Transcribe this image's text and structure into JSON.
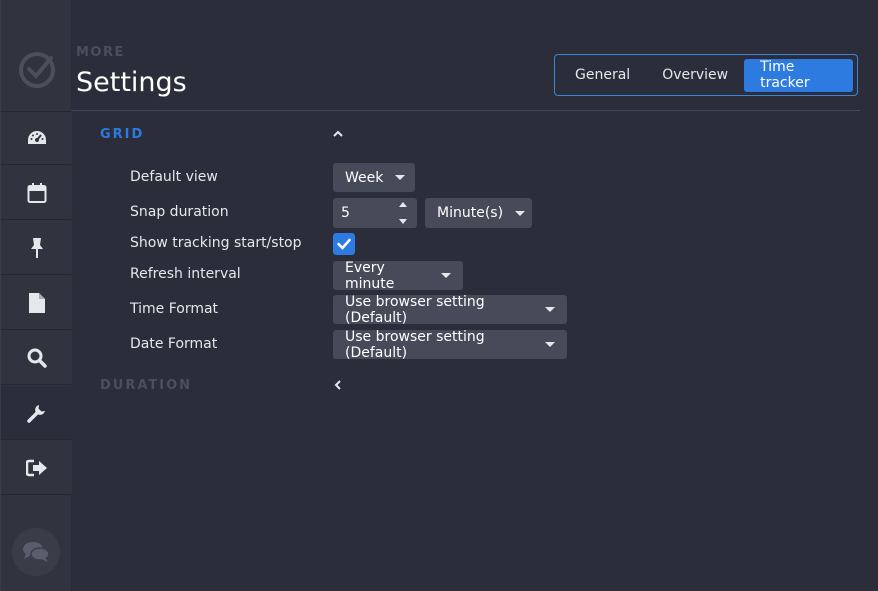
{
  "header": {
    "breadcrumb": "MORE",
    "title": "Settings",
    "tabs": [
      {
        "label": "General",
        "active": false
      },
      {
        "label": "Overview",
        "active": false
      },
      {
        "label": "Time tracker",
        "active": true
      }
    ]
  },
  "sidebar": {
    "items": [
      {
        "name": "dashboard",
        "icon": "dashboard-icon"
      },
      {
        "name": "calendar",
        "icon": "calendar-icon"
      },
      {
        "name": "pin",
        "icon": "pin-icon"
      },
      {
        "name": "document",
        "icon": "document-icon"
      },
      {
        "name": "search",
        "icon": "search-icon"
      },
      {
        "name": "settings",
        "icon": "wrench-icon",
        "active": true
      },
      {
        "name": "logout",
        "icon": "sign-out-icon"
      }
    ]
  },
  "sections": {
    "grid": {
      "label": "GRID",
      "expanded": true,
      "rows": {
        "default_view": {
          "label": "Default view",
          "value": "Week"
        },
        "snap_duration": {
          "label": "Snap duration",
          "value": "5",
          "unit": "Minute(s)"
        },
        "show_tracking": {
          "label": "Show tracking start/stop",
          "checked": true
        },
        "refresh_interval": {
          "label": "Refresh interval",
          "value": "Every minute"
        },
        "time_format": {
          "label": "Time Format",
          "value": "Use browser setting (Default)"
        },
        "date_format": {
          "label": "Date Format",
          "value": "Use browser setting (Default)"
        }
      }
    },
    "duration": {
      "label": "DURATION",
      "expanded": false
    }
  },
  "colors": {
    "accent": "#2d7ae0",
    "background": "#2b2e3a",
    "sidebar": "#31343f",
    "control": "#474a58",
    "muted": "#4b4f5c"
  }
}
